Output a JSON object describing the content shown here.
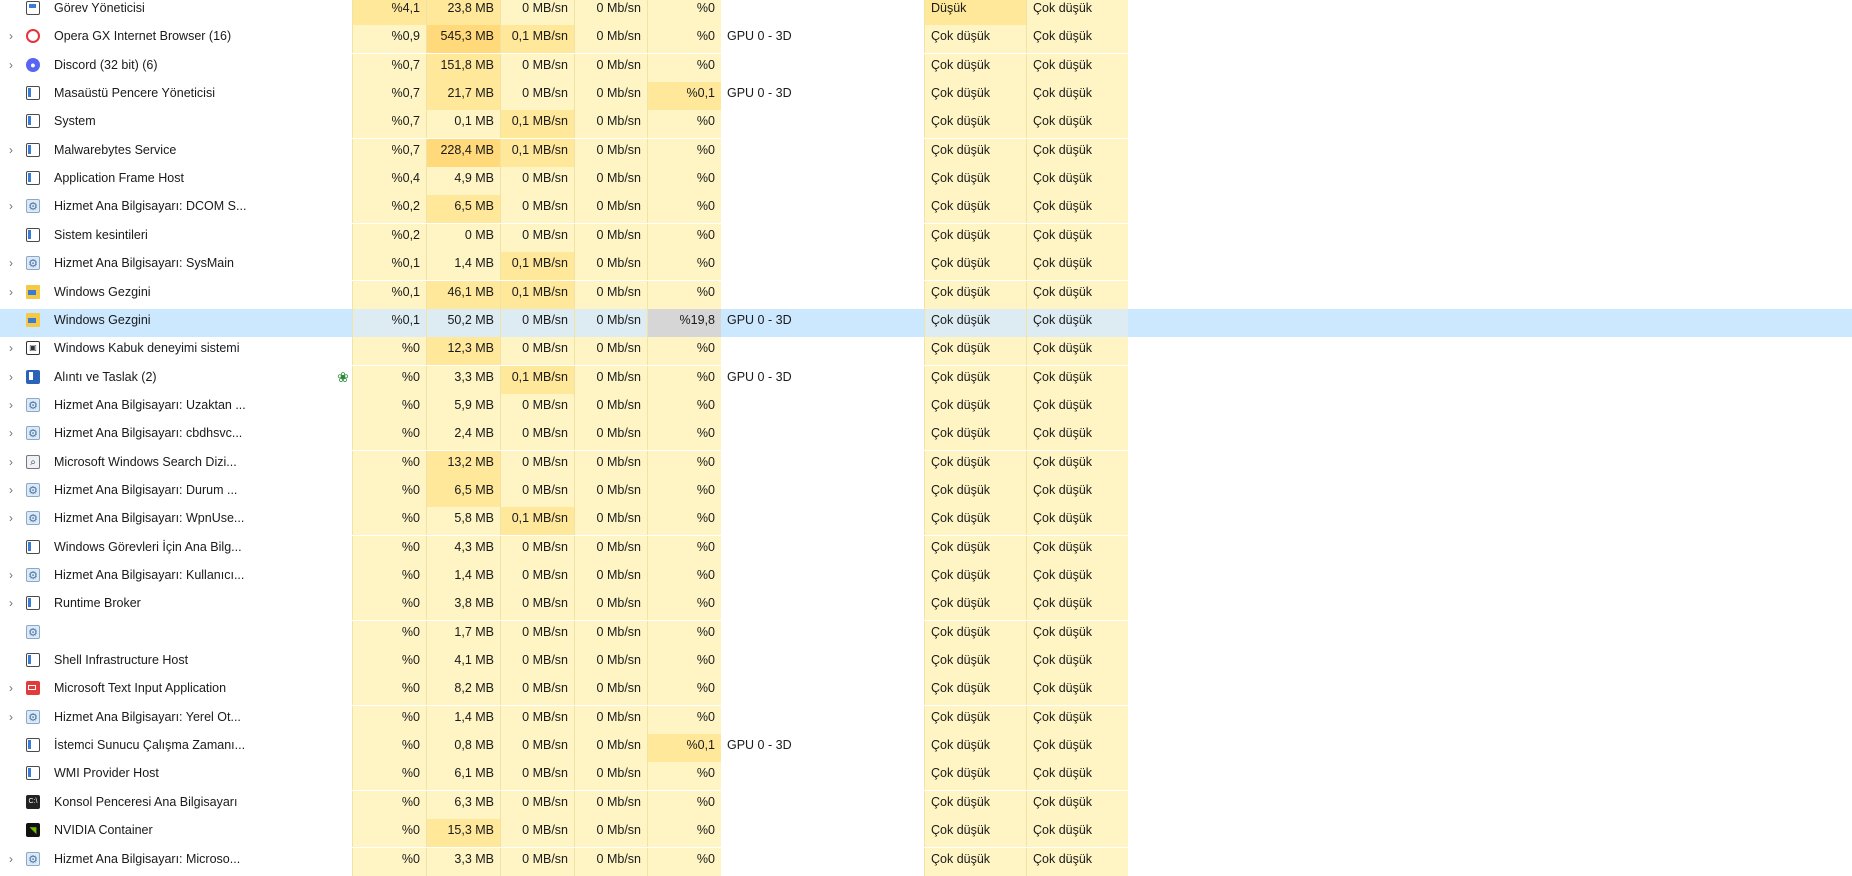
{
  "colors": {
    "heat_light": "#fff4c4",
    "heat_medium": "#ffe89a",
    "heat_strong": "#ffd97a",
    "selected_row": "#cce8ff",
    "efficiency_leaf": "#2e8b3e"
  },
  "rows": [
    {
      "expandable": false,
      "icon": "monitor-icon",
      "name": "Görev Yöneticisi",
      "cpu": "%4,1",
      "mem": "23,8 MB",
      "disk": "0 MB/sn",
      "net": "0 Mb/sn",
      "gpu": "%0",
      "gpu_engine": "",
      "power": "Düşük",
      "power_trend": "Çok düşük",
      "heat": {
        "cpu": "#ffe89a",
        "mem": "#ffe89a",
        "disk": "#fff4c4",
        "net": "#fff4c4",
        "gpu": "#fff4c4",
        "power": "#ffe89a",
        "power_trend": "#fff4c4"
      }
    },
    {
      "expandable": true,
      "icon": "opera-icon",
      "name": "Opera GX Internet Browser (16)",
      "cpu": "%0,9",
      "mem": "545,3 MB",
      "disk": "0,1 MB/sn",
      "net": "0 Mb/sn",
      "gpu": "%0",
      "gpu_engine": "GPU 0 - 3D",
      "power": "Çok düşük",
      "power_trend": "Çok düşük",
      "heat": {
        "cpu": "#fff4c4",
        "mem": "#ffd97a",
        "disk": "#ffe89a",
        "net": "#fff4c4",
        "gpu": "#fff4c4",
        "power": "#fff4c4",
        "power_trend": "#fff4c4"
      }
    },
    {
      "expandable": true,
      "icon": "discord-icon",
      "name": "Discord (32 bit) (6)",
      "cpu": "%0,7",
      "mem": "151,8 MB",
      "disk": "0 MB/sn",
      "net": "0 Mb/sn",
      "gpu": "%0",
      "gpu_engine": "",
      "power": "Çok düşük",
      "power_trend": "Çok düşük",
      "heat": {
        "cpu": "#fff4c4",
        "mem": "#ffe89a",
        "disk": "#fff4c4",
        "net": "#fff4c4",
        "gpu": "#fff4c4",
        "power": "#fff4c4",
        "power_trend": "#fff4c4"
      }
    },
    {
      "expandable": false,
      "icon": "window-icon",
      "name": "Masaüstü Pencere Yöneticisi",
      "cpu": "%0,7",
      "mem": "21,7 MB",
      "disk": "0 MB/sn",
      "net": "0 Mb/sn",
      "gpu": "%0,1",
      "gpu_engine": "GPU 0 - 3D",
      "power": "Çok düşük",
      "power_trend": "Çok düşük",
      "heat": {
        "cpu": "#fff4c4",
        "mem": "#ffe89a",
        "disk": "#fff4c4",
        "net": "#fff4c4",
        "gpu": "#ffe89a",
        "power": "#fff4c4",
        "power_trend": "#fff4c4"
      }
    },
    {
      "expandable": false,
      "icon": "window-icon",
      "name": "System",
      "cpu": "%0,7",
      "mem": "0,1 MB",
      "disk": "0,1 MB/sn",
      "net": "0 Mb/sn",
      "gpu": "%0",
      "gpu_engine": "",
      "power": "Çok düşük",
      "power_trend": "Çok düşük",
      "heat": {
        "cpu": "#fff4c4",
        "mem": "#fff4c4",
        "disk": "#ffe89a",
        "net": "#fff4c4",
        "gpu": "#fff4c4",
        "power": "#fff4c4",
        "power_trend": "#fff4c4"
      }
    },
    {
      "expandable": true,
      "icon": "window-icon",
      "name": "Malwarebytes Service",
      "cpu": "%0,7",
      "mem": "228,4 MB",
      "disk": "0,1 MB/sn",
      "net": "0 Mb/sn",
      "gpu": "%0",
      "gpu_engine": "",
      "power": "Çok düşük",
      "power_trend": "Çok düşük",
      "heat": {
        "cpu": "#fff4c4",
        "mem": "#ffd97a",
        "disk": "#ffe89a",
        "net": "#fff4c4",
        "gpu": "#fff4c4",
        "power": "#fff4c4",
        "power_trend": "#fff4c4"
      }
    },
    {
      "expandable": false,
      "icon": "window-icon",
      "name": "Application Frame Host",
      "cpu": "%0,4",
      "mem": "4,9 MB",
      "disk": "0 MB/sn",
      "net": "0 Mb/sn",
      "gpu": "%0",
      "gpu_engine": "",
      "power": "Çok düşük",
      "power_trend": "Çok düşük",
      "heat": {
        "cpu": "#fff4c4",
        "mem": "#fff4c4",
        "disk": "#fff4c4",
        "net": "#fff4c4",
        "gpu": "#fff4c4",
        "power": "#fff4c4",
        "power_trend": "#fff4c4"
      }
    },
    {
      "expandable": true,
      "icon": "gear-icon",
      "name": "Hizmet Ana Bilgisayarı: DCOM S...",
      "cpu": "%0,2",
      "mem": "6,5 MB",
      "disk": "0 MB/sn",
      "net": "0 Mb/sn",
      "gpu": "%0",
      "gpu_engine": "",
      "power": "Çok düşük",
      "power_trend": "Çok düşük",
      "heat": {
        "cpu": "#fff4c4",
        "mem": "#ffe89a",
        "disk": "#fff4c4",
        "net": "#fff4c4",
        "gpu": "#fff4c4",
        "power": "#fff4c4",
        "power_trend": "#fff4c4"
      }
    },
    {
      "expandable": false,
      "icon": "window-icon",
      "name": "Sistem kesintileri",
      "cpu": "%0,2",
      "mem": "0 MB",
      "disk": "0 MB/sn",
      "net": "0 Mb/sn",
      "gpu": "%0",
      "gpu_engine": "",
      "power": "Çok düşük",
      "power_trend": "Çok düşük",
      "heat": {
        "cpu": "#fff4c4",
        "mem": "#fff4c4",
        "disk": "#fff4c4",
        "net": "#fff4c4",
        "gpu": "#fff4c4",
        "power": "#fff4c4",
        "power_trend": "#fff4c4"
      }
    },
    {
      "expandable": true,
      "icon": "gear-icon",
      "name": "Hizmet Ana Bilgisayarı: SysMain",
      "cpu": "%0,1",
      "mem": "1,4 MB",
      "disk": "0,1 MB/sn",
      "net": "0 Mb/sn",
      "gpu": "%0",
      "gpu_engine": "",
      "power": "Çok düşük",
      "power_trend": "Çok düşük",
      "heat": {
        "cpu": "#fff4c4",
        "mem": "#fff4c4",
        "disk": "#ffe89a",
        "net": "#fff4c4",
        "gpu": "#fff4c4",
        "power": "#fff4c4",
        "power_trend": "#fff4c4"
      }
    },
    {
      "expandable": true,
      "icon": "folder-icon",
      "name": "Windows Gezgini",
      "cpu": "%0,1",
      "mem": "46,1 MB",
      "disk": "0,1 MB/sn",
      "net": "0 Mb/sn",
      "gpu": "%0",
      "gpu_engine": "",
      "power": "Çok düşük",
      "power_trend": "Çok düşük",
      "heat": {
        "cpu": "#fff4c4",
        "mem": "#ffe89a",
        "disk": "#ffe89a",
        "net": "#fff4c4",
        "gpu": "#fff4c4",
        "power": "#fff4c4",
        "power_trend": "#fff4c4"
      }
    },
    {
      "expandable": false,
      "selected": true,
      "icon": "folder-icon",
      "name": "Windows Gezgini",
      "cpu": "%0,1",
      "mem": "50,2 MB",
      "disk": "0 MB/sn",
      "net": "0 Mb/sn",
      "gpu": "%19,8",
      "gpu_engine": "GPU 0 - 3D",
      "power": "Çok düşük",
      "power_trend": "Çok düşük",
      "heat": {
        "cpu": "#dcecf2",
        "mem": "#dcecf2",
        "disk": "#dcecf2",
        "net": "#dcecf2",
        "gpu": "#d6d6d6",
        "power": "#dcecf2",
        "power_trend": "#dcecf2"
      }
    },
    {
      "expandable": true,
      "icon": "shell-icon",
      "name": "Windows Kabuk deneyimi sistemi",
      "cpu": "%0",
      "mem": "12,3 MB",
      "disk": "0 MB/sn",
      "net": "0 Mb/sn",
      "gpu": "%0",
      "gpu_engine": "",
      "power": "Çok düşük",
      "power_trend": "Çok düşük",
      "heat": {
        "cpu": "#fff4c4",
        "mem": "#ffe89a",
        "disk": "#fff4c4",
        "net": "#fff4c4",
        "gpu": "#fff4c4",
        "power": "#fff4c4",
        "power_trend": "#fff4c4"
      }
    },
    {
      "expandable": true,
      "icon": "snip-icon",
      "name": "Alıntı ve Taslak (2)",
      "efficiency": true,
      "cpu": "%0",
      "mem": "3,3 MB",
      "disk": "0,1 MB/sn",
      "net": "0 Mb/sn",
      "gpu": "%0",
      "gpu_engine": "GPU 0 - 3D",
      "power": "Çok düşük",
      "power_trend": "Çok düşük",
      "heat": {
        "cpu": "#fff4c4",
        "mem": "#fff4c4",
        "disk": "#ffe89a",
        "net": "#fff4c4",
        "gpu": "#fff4c4",
        "power": "#fff4c4",
        "power_trend": "#fff4c4"
      }
    },
    {
      "expandable": true,
      "icon": "gear-icon",
      "name": "Hizmet Ana Bilgisayarı: Uzaktan ...",
      "cpu": "%0",
      "mem": "5,9 MB",
      "disk": "0 MB/sn",
      "net": "0 Mb/sn",
      "gpu": "%0",
      "gpu_engine": "",
      "power": "Çok düşük",
      "power_trend": "Çok düşük",
      "heat": {
        "cpu": "#fff4c4",
        "mem": "#fff4c4",
        "disk": "#fff4c4",
        "net": "#fff4c4",
        "gpu": "#fff4c4",
        "power": "#fff4c4",
        "power_trend": "#fff4c4"
      }
    },
    {
      "expandable": true,
      "icon": "gear-icon",
      "name": "Hizmet Ana Bilgisayarı: cbdhsvc...",
      "cpu": "%0",
      "mem": "2,4 MB",
      "disk": "0 MB/sn",
      "net": "0 Mb/sn",
      "gpu": "%0",
      "gpu_engine": "",
      "power": "Çok düşük",
      "power_trend": "Çok düşük",
      "heat": {
        "cpu": "#fff4c4",
        "mem": "#fff4c4",
        "disk": "#fff4c4",
        "net": "#fff4c4",
        "gpu": "#fff4c4",
        "power": "#fff4c4",
        "power_trend": "#fff4c4"
      }
    },
    {
      "expandable": true,
      "icon": "search-icon",
      "name": "Microsoft Windows Search Dizi...",
      "cpu": "%0",
      "mem": "13,2 MB",
      "disk": "0 MB/sn",
      "net": "0 Mb/sn",
      "gpu": "%0",
      "gpu_engine": "",
      "power": "Çok düşük",
      "power_trend": "Çok düşük",
      "heat": {
        "cpu": "#fff4c4",
        "mem": "#ffe89a",
        "disk": "#fff4c4",
        "net": "#fff4c4",
        "gpu": "#fff4c4",
        "power": "#fff4c4",
        "power_trend": "#fff4c4"
      }
    },
    {
      "expandable": true,
      "icon": "gear-icon",
      "name": "Hizmet Ana Bilgisayarı: Durum ...",
      "cpu": "%0",
      "mem": "6,5 MB",
      "disk": "0 MB/sn",
      "net": "0 Mb/sn",
      "gpu": "%0",
      "gpu_engine": "",
      "power": "Çok düşük",
      "power_trend": "Çok düşük",
      "heat": {
        "cpu": "#fff4c4",
        "mem": "#ffe89a",
        "disk": "#fff4c4",
        "net": "#fff4c4",
        "gpu": "#fff4c4",
        "power": "#fff4c4",
        "power_trend": "#fff4c4"
      }
    },
    {
      "expandable": true,
      "icon": "gear-icon",
      "name": "Hizmet Ana Bilgisayarı: WpnUse...",
      "cpu": "%0",
      "mem": "5,8 MB",
      "disk": "0,1 MB/sn",
      "net": "0 Mb/sn",
      "gpu": "%0",
      "gpu_engine": "",
      "power": "Çok düşük",
      "power_trend": "Çok düşük",
      "heat": {
        "cpu": "#fff4c4",
        "mem": "#fff4c4",
        "disk": "#ffe89a",
        "net": "#fff4c4",
        "gpu": "#fff4c4",
        "power": "#fff4c4",
        "power_trend": "#fff4c4"
      }
    },
    {
      "expandable": false,
      "icon": "window-icon",
      "name": "Windows Görevleri İçin Ana Bilg...",
      "cpu": "%0",
      "mem": "4,3 MB",
      "disk": "0 MB/sn",
      "net": "0 Mb/sn",
      "gpu": "%0",
      "gpu_engine": "",
      "power": "Çok düşük",
      "power_trend": "Çok düşük",
      "heat": {
        "cpu": "#fff4c4",
        "mem": "#fff4c4",
        "disk": "#fff4c4",
        "net": "#fff4c4",
        "gpu": "#fff4c4",
        "power": "#fff4c4",
        "power_trend": "#fff4c4"
      }
    },
    {
      "expandable": true,
      "icon": "gear-icon",
      "name": "Hizmet Ana Bilgisayarı: Kullanıcı...",
      "cpu": "%0",
      "mem": "1,4 MB",
      "disk": "0 MB/sn",
      "net": "0 Mb/sn",
      "gpu": "%0",
      "gpu_engine": "",
      "power": "Çok düşük",
      "power_trend": "Çok düşük",
      "heat": {
        "cpu": "#fff4c4",
        "mem": "#fff4c4",
        "disk": "#fff4c4",
        "net": "#fff4c4",
        "gpu": "#fff4c4",
        "power": "#fff4c4",
        "power_trend": "#fff4c4"
      }
    },
    {
      "expandable": true,
      "icon": "window-icon",
      "name": "Runtime Broker",
      "cpu": "%0",
      "mem": "3,8 MB",
      "disk": "0 MB/sn",
      "net": "0 Mb/sn",
      "gpu": "%0",
      "gpu_engine": "",
      "power": "Çok düşük",
      "power_trend": "Çok düşük",
      "heat": {
        "cpu": "#fff4c4",
        "mem": "#fff4c4",
        "disk": "#fff4c4",
        "net": "#fff4c4",
        "gpu": "#fff4c4",
        "power": "#fff4c4",
        "power_trend": "#fff4c4"
      }
    },
    {
      "expandable": false,
      "icon": "gear-icon",
      "name": "",
      "cpu": "%0",
      "mem": "1,7 MB",
      "disk": "0 MB/sn",
      "net": "0 Mb/sn",
      "gpu": "%0",
      "gpu_engine": "",
      "power": "Çok düşük",
      "power_trend": "Çok düşük",
      "heat": {
        "cpu": "#fff4c4",
        "mem": "#fff4c4",
        "disk": "#fff4c4",
        "net": "#fff4c4",
        "gpu": "#fff4c4",
        "power": "#fff4c4",
        "power_trend": "#fff4c4"
      }
    },
    {
      "expandable": false,
      "icon": "window-icon",
      "name": "Shell Infrastructure Host",
      "cpu": "%0",
      "mem": "4,1 MB",
      "disk": "0 MB/sn",
      "net": "0 Mb/sn",
      "gpu": "%0",
      "gpu_engine": "",
      "power": "Çok düşük",
      "power_trend": "Çok düşük",
      "heat": {
        "cpu": "#fff4c4",
        "mem": "#fff4c4",
        "disk": "#fff4c4",
        "net": "#fff4c4",
        "gpu": "#fff4c4",
        "power": "#fff4c4",
        "power_trend": "#fff4c4"
      }
    },
    {
      "expandable": true,
      "icon": "keyboard-icon",
      "name": "Microsoft Text Input Application",
      "cpu": "%0",
      "mem": "8,2 MB",
      "disk": "0 MB/sn",
      "net": "0 Mb/sn",
      "gpu": "%0",
      "gpu_engine": "",
      "power": "Çok düşük",
      "power_trend": "Çok düşük",
      "heat": {
        "cpu": "#fff4c4",
        "mem": "#fff4c4",
        "disk": "#fff4c4",
        "net": "#fff4c4",
        "gpu": "#fff4c4",
        "power": "#fff4c4",
        "power_trend": "#fff4c4"
      }
    },
    {
      "expandable": true,
      "icon": "gear-icon",
      "name": "Hizmet Ana Bilgisayarı: Yerel Ot...",
      "cpu": "%0",
      "mem": "1,4 MB",
      "disk": "0 MB/sn",
      "net": "0 Mb/sn",
      "gpu": "%0",
      "gpu_engine": "",
      "power": "Çok düşük",
      "power_trend": "Çok düşük",
      "heat": {
        "cpu": "#fff4c4",
        "mem": "#fff4c4",
        "disk": "#fff4c4",
        "net": "#fff4c4",
        "gpu": "#fff4c4",
        "power": "#fff4c4",
        "power_trend": "#fff4c4"
      }
    },
    {
      "expandable": false,
      "icon": "window-icon",
      "name": "İstemci Sunucu Çalışma Zamanı...",
      "cpu": "%0",
      "mem": "0,8 MB",
      "disk": "0 MB/sn",
      "net": "0 Mb/sn",
      "gpu": "%0,1",
      "gpu_engine": "GPU 0 - 3D",
      "power": "Çok düşük",
      "power_trend": "Çok düşük",
      "heat": {
        "cpu": "#fff4c4",
        "mem": "#fff4c4",
        "disk": "#fff4c4",
        "net": "#fff4c4",
        "gpu": "#ffe89a",
        "power": "#fff4c4",
        "power_trend": "#fff4c4"
      }
    },
    {
      "expandable": false,
      "icon": "window-icon",
      "name": "WMI Provider Host",
      "cpu": "%0",
      "mem": "6,1 MB",
      "disk": "0 MB/sn",
      "net": "0 Mb/sn",
      "gpu": "%0",
      "gpu_engine": "",
      "power": "Çok düşük",
      "power_trend": "Çok düşük",
      "heat": {
        "cpu": "#fff4c4",
        "mem": "#fff4c4",
        "disk": "#fff4c4",
        "net": "#fff4c4",
        "gpu": "#fff4c4",
        "power": "#fff4c4",
        "power_trend": "#fff4c4"
      }
    },
    {
      "expandable": false,
      "icon": "console-icon",
      "name": "Konsol Penceresi Ana Bilgisayarı",
      "cpu": "%0",
      "mem": "6,3 MB",
      "disk": "0 MB/sn",
      "net": "0 Mb/sn",
      "gpu": "%0",
      "gpu_engine": "",
      "power": "Çok düşük",
      "power_trend": "Çok düşük",
      "heat": {
        "cpu": "#fff4c4",
        "mem": "#fff4c4",
        "disk": "#fff4c4",
        "net": "#fff4c4",
        "gpu": "#fff4c4",
        "power": "#fff4c4",
        "power_trend": "#fff4c4"
      }
    },
    {
      "expandable": false,
      "icon": "nvidia-icon",
      "name": "NVIDIA Container",
      "cpu": "%0",
      "mem": "15,3 MB",
      "disk": "0 MB/sn",
      "net": "0 Mb/sn",
      "gpu": "%0",
      "gpu_engine": "",
      "power": "Çok düşük",
      "power_trend": "Çok düşük",
      "heat": {
        "cpu": "#fff4c4",
        "mem": "#ffe89a",
        "disk": "#fff4c4",
        "net": "#fff4c4",
        "gpu": "#fff4c4",
        "power": "#fff4c4",
        "power_trend": "#fff4c4"
      }
    },
    {
      "expandable": true,
      "icon": "gear-icon",
      "name": "Hizmet Ana Bilgisayarı: Microso...",
      "cpu": "%0",
      "mem": "3,3 MB",
      "disk": "0 MB/sn",
      "net": "0 Mb/sn",
      "gpu": "%0",
      "gpu_engine": "",
      "power": "Çok düşük",
      "power_trend": "Çok düşük",
      "heat": {
        "cpu": "#fff4c4",
        "mem": "#fff4c4",
        "disk": "#fff4c4",
        "net": "#fff4c4",
        "gpu": "#fff4c4",
        "power": "#fff4c4",
        "power_trend": "#fff4c4"
      }
    }
  ]
}
